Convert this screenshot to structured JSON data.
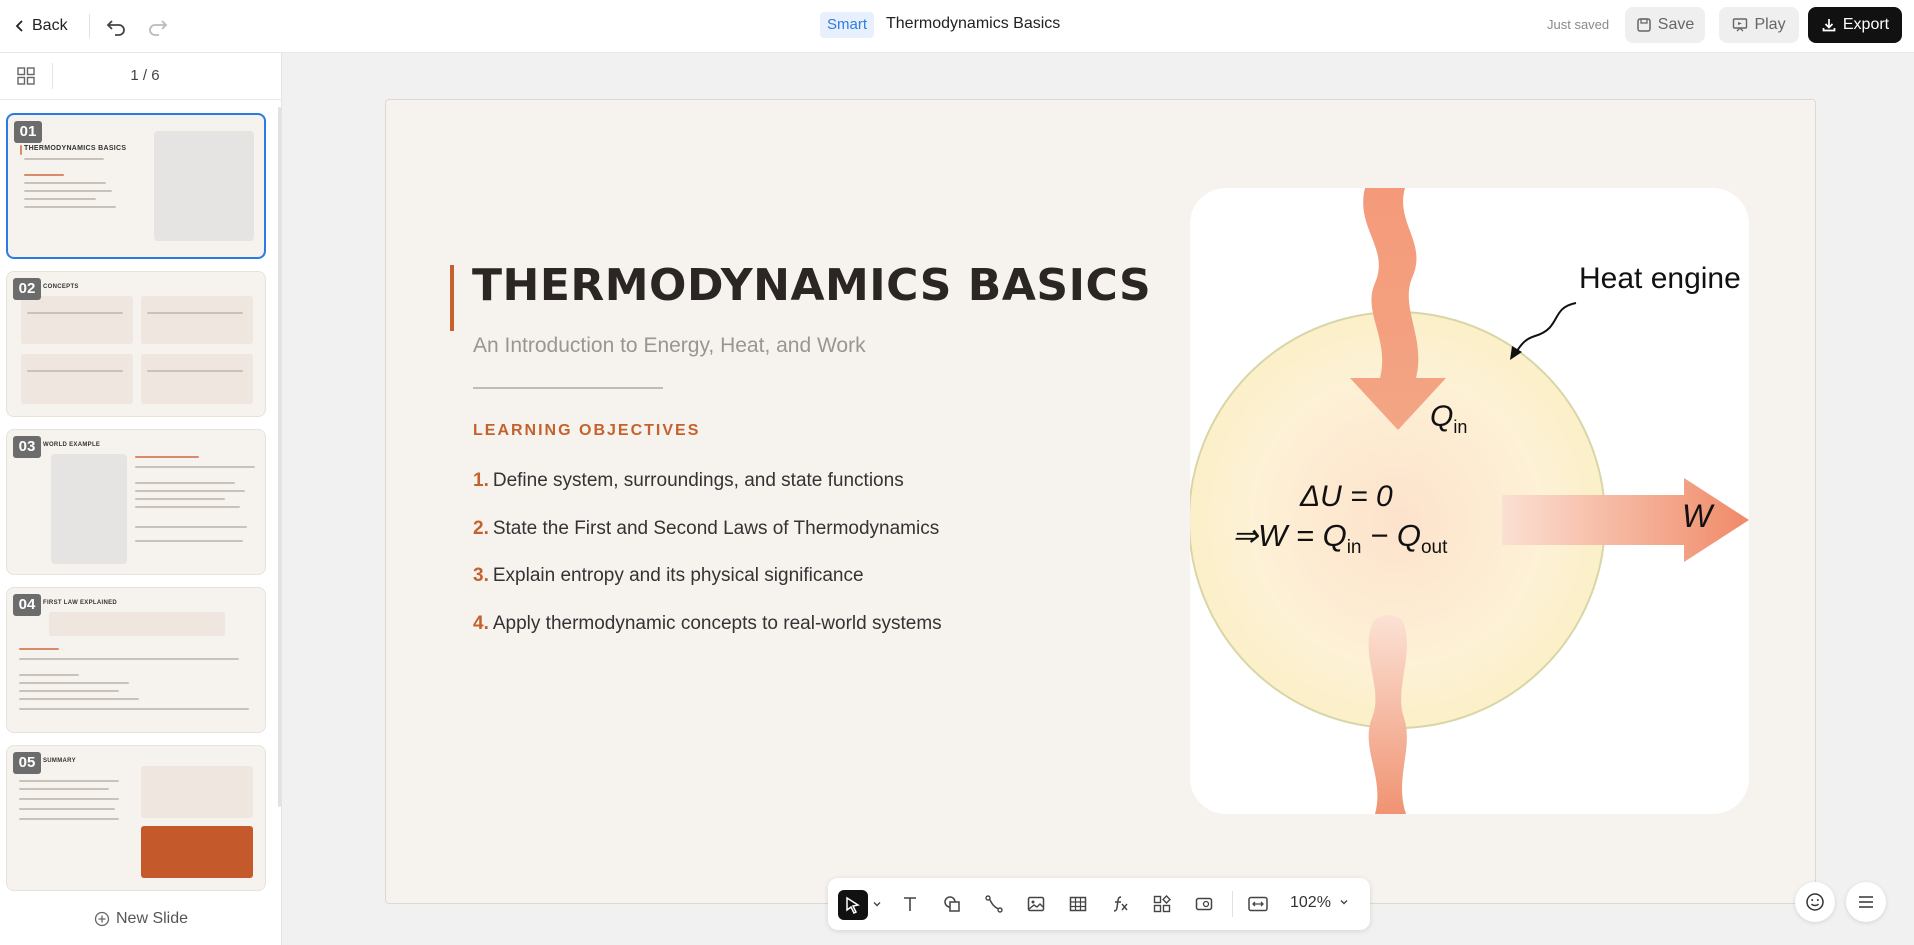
{
  "header": {
    "back_label": "Back",
    "mode_badge": "Smart",
    "title": "Thermodynamics Basics",
    "saved_status": "Just saved",
    "save_label": "Save",
    "play_label": "Play",
    "export_label": "Export"
  },
  "sidebar": {
    "page_indicator": "1 / 6",
    "new_slide_label": "New Slide",
    "slides": [
      {
        "num": "01",
        "title": "THERMODYNAMICS BASICS"
      },
      {
        "num": "02",
        "title": "CONCEPTS"
      },
      {
        "num": "03",
        "title": "WORLD EXAMPLE"
      },
      {
        "num": "04",
        "title": "FIRST LAW EXPLAINED"
      },
      {
        "num": "05",
        "title": "SUMMARY"
      }
    ]
  },
  "slide": {
    "title": "THERMODYNAMICS BASICS",
    "subtitle": "An Introduction to Energy, Heat, and Work",
    "objectives_heading": "LEARNING OBJECTIVES",
    "objectives": [
      {
        "n": "1.",
        "text": "Define system, surroundings, and state functions"
      },
      {
        "n": "2.",
        "text": "State the First and Second Laws of Thermodynamics"
      },
      {
        "n": "3.",
        "text": "Explain entropy and its physical significance"
      },
      {
        "n": "4.",
        "text": "Apply thermodynamic concepts to real-world systems"
      }
    ],
    "figure": {
      "label": "Heat engine",
      "q_in": "Q",
      "q_in_sub": "in",
      "w": "W",
      "eq1": "ΔU = 0",
      "eq2_prefix": "⇒W = Q",
      "eq2_sub1": "in",
      "eq2_mid": " − Q",
      "eq2_sub2": "out"
    }
  },
  "toolbar": {
    "zoom": "102%"
  },
  "colors": {
    "accent": "#c4622d",
    "selection": "#2a7be4",
    "export_bg": "#111111"
  }
}
